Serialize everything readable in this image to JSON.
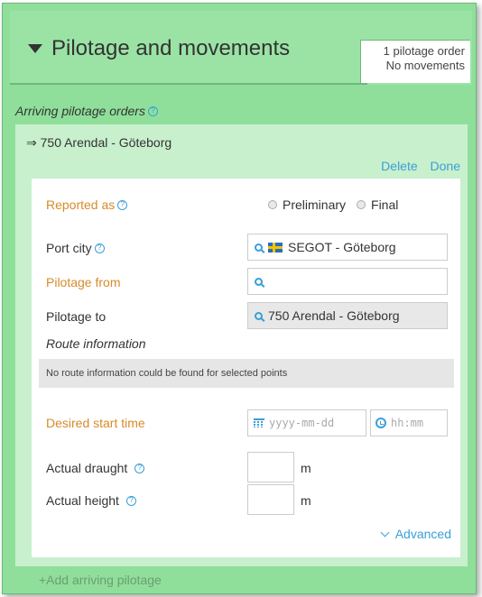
{
  "header": {
    "title": "Pilotage and movements",
    "summary_line1": "1 pilotage order",
    "summary_line2": "No movements"
  },
  "arriving": {
    "section_label": "Arriving pilotage orders",
    "add_label": "+Add arriving pilotage"
  },
  "order": {
    "title": "⇒ 750 Arendal - Göteborg",
    "delete_label": "Delete",
    "done_label": "Done"
  },
  "form": {
    "reported_as_label": "Reported as",
    "option_preliminary": "Preliminary",
    "option_final": "Final",
    "port_city_label": "Port city",
    "port_city_value": "SEGOT - Göteborg",
    "pilotage_from_label": "Pilotage from",
    "pilotage_from_value": "",
    "pilotage_to_label": "Pilotage to",
    "pilotage_to_value": "750 Arendal - Göteborg",
    "route_info_label": "Route information",
    "route_note": "No route information could be found for selected points",
    "desired_start_label": "Desired start time",
    "date_placeholder": "yyyy-mm-dd",
    "time_placeholder": "hh:mm",
    "actual_draught_label": "Actual draught",
    "actual_height_label": "Actual height",
    "unit_m": "m",
    "advanced_label": "Advanced"
  },
  "colors": {
    "panel_bg": "#8fdf9a",
    "card_bg": "#c8f0cd",
    "accent_blue": "#3a9fd8",
    "required_orange": "#d88a2a"
  }
}
